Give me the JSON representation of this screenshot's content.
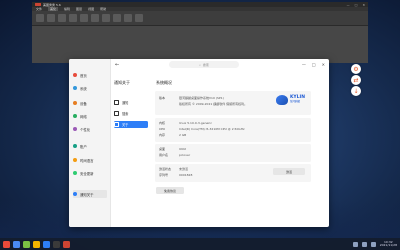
{
  "background_app": {
    "title": "美图秀秀 5.6",
    "menu": [
      "文件",
      "美化",
      "编辑",
      "图层",
      "视图",
      "帮助"
    ],
    "window_buttons": [
      "—",
      "□",
      "✕"
    ]
  },
  "settings": {
    "back_glyph": "←",
    "search_placeholder": "搜索",
    "window_controls": [
      "—",
      "□",
      "✕"
    ],
    "sidebar": [
      {
        "label": "首页",
        "color": "#e74c3c"
      },
      {
        "label": "系统",
        "color": "#3498db"
      },
      {
        "label": "设备",
        "color": "#e67e22"
      },
      {
        "label": "网络",
        "color": "#27ae60"
      },
      {
        "label": "个性化",
        "color": "#9b59b6"
      },
      {
        "label": "账户",
        "color": "#16a085"
      },
      {
        "label": "时间语言",
        "color": "#f39c12"
      },
      {
        "label": "安全更新",
        "color": "#2ecc71"
      },
      {
        "label": "通知关于",
        "color": "#2d7ef7"
      }
    ],
    "sub_title": "通知关于",
    "sub_items": [
      "通知",
      "搜索",
      "关于"
    ],
    "main_title": "系统概况",
    "version": {
      "label": "版本",
      "value": "银河麒麟桌面操作系统V10 (SP1)",
      "copyright": "版权所有 © 2009-2021 麒麟软件 保留所有权利。",
      "logo_name": "KYLIN",
      "logo_sub": "银河麒麟"
    },
    "hardware": [
      {
        "k": "内核",
        "v": "linux 5.10.0-3-generic"
      },
      {
        "k": "CPU",
        "v": "Intel(R) Core(TM) i5-3210M CPU @ 2.50GHz"
      },
      {
        "k": "内存",
        "v": "2 GB"
      }
    ],
    "desktop": [
      {
        "k": "桌面",
        "v": "UKUI"
      },
      {
        "k": "用户名",
        "v": "pclover"
      }
    ],
    "activation": [
      {
        "k": "激活状态",
        "v": "未激活"
      },
      {
        "k": "序列号",
        "v": "0001828"
      }
    ],
    "activate_button": "激活",
    "disclaimer_button": "免责协议"
  },
  "taskbar": {
    "apps": [
      "#e84a3a",
      "#4a8af4",
      "#7bc043",
      "#f4b400",
      "#2d7ef7",
      "#3a3a3a",
      "#c43"
    ],
    "time": "10:32",
    "date": "2021/11/28"
  }
}
